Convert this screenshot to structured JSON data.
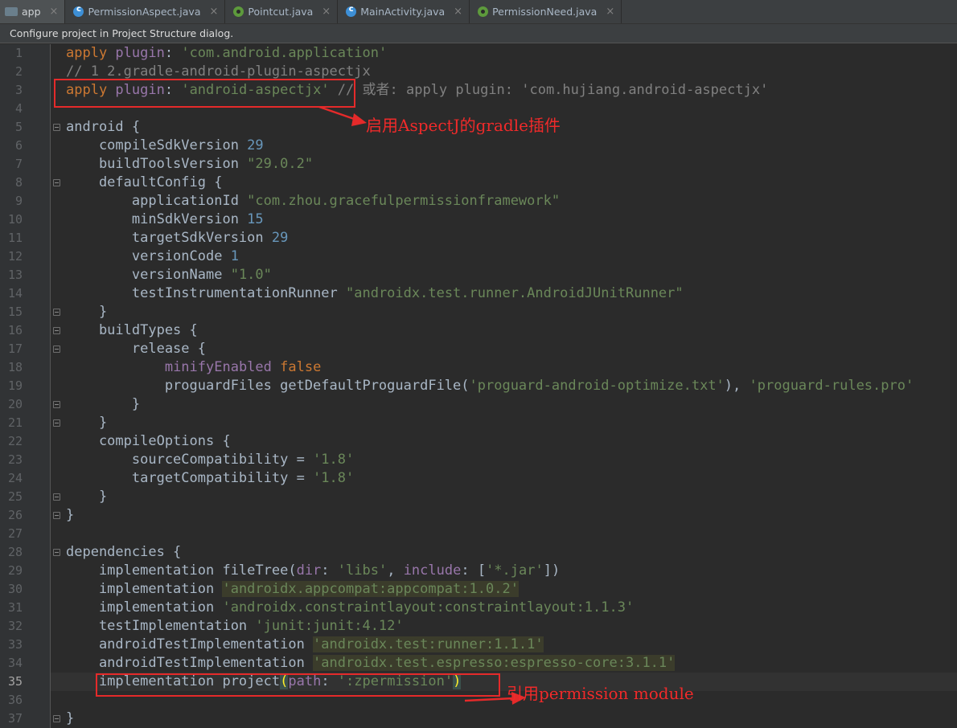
{
  "tabs": [
    {
      "label": "app",
      "icon": "android-module-icon",
      "active": true
    },
    {
      "label": "PermissionAspect.java",
      "icon": "java-class-icon"
    },
    {
      "label": "Pointcut.java",
      "icon": "annotation-icon"
    },
    {
      "label": "MainActivity.java",
      "icon": "java-class-icon"
    },
    {
      "label": "PermissionNeed.java",
      "icon": "annotation-icon"
    }
  ],
  "banner": {
    "text": "Configure project in Project Structure dialog."
  },
  "editor": {
    "current_line": 35,
    "line_numbers": [
      "1",
      "2",
      "3",
      "4",
      "5",
      "6",
      "7",
      "8",
      "9",
      "10",
      "11",
      "12",
      "13",
      "14",
      "15",
      "16",
      "17",
      "18",
      "19",
      "20",
      "21",
      "22",
      "23",
      "24",
      "25",
      "26",
      "27",
      "28",
      "29",
      "30",
      "31",
      "32",
      "33",
      "34",
      "35",
      "36",
      "37"
    ]
  },
  "code": [
    [
      [
        "k",
        "apply"
      ],
      [
        "p",
        " plugin"
      ],
      [
        "pn",
        ": "
      ],
      [
        "s",
        "'com.android.application'"
      ]
    ],
    [
      [
        "c",
        "// 1 2.gradle-android-plugin-aspectjx"
      ]
    ],
    [
      [
        "k",
        "apply"
      ],
      [
        "p",
        " plugin"
      ],
      [
        "pn",
        ": "
      ],
      [
        "s",
        "'android-aspectjx'"
      ],
      [
        "c",
        " // 或者: apply plugin: 'com.hujiang.android-aspectjx'"
      ]
    ],
    [],
    [
      [
        "pn",
        "android {"
      ]
    ],
    [
      [
        "pn",
        "    compileSdkVersion "
      ],
      [
        "n",
        "29"
      ]
    ],
    [
      [
        "pn",
        "    buildToolsVersion "
      ],
      [
        "s",
        "\"29.0.2\""
      ]
    ],
    [
      [
        "pn",
        "    defaultConfig {"
      ]
    ],
    [
      [
        "pn",
        "        applicationId "
      ],
      [
        "s",
        "\"com.zhou.gracefulpermissionframework\""
      ]
    ],
    [
      [
        "pn",
        "        minSdkVersion "
      ],
      [
        "n",
        "15"
      ]
    ],
    [
      [
        "pn",
        "        targetSdkVersion "
      ],
      [
        "n",
        "29"
      ]
    ],
    [
      [
        "pn",
        "        versionCode "
      ],
      [
        "n",
        "1"
      ]
    ],
    [
      [
        "pn",
        "        versionName "
      ],
      [
        "s",
        "\"1.0\""
      ]
    ],
    [
      [
        "pn",
        "        testInstrumentationRunner "
      ],
      [
        "s",
        "\"androidx.test.runner.AndroidJUnitRunner\""
      ]
    ],
    [
      [
        "pn",
        "    }"
      ]
    ],
    [
      [
        "pn",
        "    buildTypes {"
      ]
    ],
    [
      [
        "pn",
        "        release {"
      ]
    ],
    [
      [
        "pn",
        "            "
      ],
      [
        "p",
        "minifyEnabled "
      ],
      [
        "k",
        "false"
      ]
    ],
    [
      [
        "pn",
        "            proguardFiles getDefaultProguardFile("
      ],
      [
        "s",
        "'proguard-android-optimize.txt'"
      ],
      [
        "pn",
        "), "
      ],
      [
        "s",
        "'proguard-rules.pro'"
      ]
    ],
    [
      [
        "pn",
        "        }"
      ]
    ],
    [
      [
        "pn",
        "    }"
      ]
    ],
    [
      [
        "pn",
        "    compileOptions {"
      ]
    ],
    [
      [
        "pn",
        "        sourceCompatibility = "
      ],
      [
        "s",
        "'1.8'"
      ]
    ],
    [
      [
        "pn",
        "        targetCompatibility = "
      ],
      [
        "s",
        "'1.8'"
      ]
    ],
    [
      [
        "pn",
        "    }"
      ]
    ],
    [
      [
        "pn",
        "}"
      ]
    ],
    [],
    [
      [
        "pn",
        "dependencies {"
      ]
    ],
    [
      [
        "pn",
        "    implementation fileTree("
      ],
      [
        "p",
        "dir"
      ],
      [
        "pn",
        ": "
      ],
      [
        "s",
        "'libs'"
      ],
      [
        "pn",
        ", "
      ],
      [
        "p",
        "include"
      ],
      [
        "pn",
        ": ["
      ],
      [
        "s",
        "'*.jar'"
      ],
      [
        "pn",
        "])"
      ]
    ],
    [
      [
        "pn",
        "    implementation "
      ],
      [
        "s hl",
        "'androidx.appcompat:appcompat:1.0.2'"
      ]
    ],
    [
      [
        "pn",
        "    implementation "
      ],
      [
        "s",
        "'androidx.constraintlayout:constraintlayout:1.1.3'"
      ]
    ],
    [
      [
        "pn",
        "    testImplementation "
      ],
      [
        "s",
        "'junit:junit:4.12'"
      ]
    ],
    [
      [
        "pn",
        "    androidTestImplementation "
      ],
      [
        "s hl",
        "'androidx.test:runner:1.1.1'"
      ]
    ],
    [
      [
        "pn",
        "    androidTestImplementation "
      ],
      [
        "s hl",
        "'androidx.test.espresso:espresso-core:3.1.1'"
      ]
    ],
    [
      [
        "pn",
        "    implementation project"
      ],
      [
        "br",
        "("
      ],
      [
        "p",
        "path"
      ],
      [
        "pn",
        ": "
      ],
      [
        "s",
        "':zpermission'"
      ],
      [
        "br",
        ")"
      ]
    ],
    [],
    [
      [
        "pn",
        "}"
      ]
    ]
  ],
  "annotations": {
    "first": "启用AspectJ的gradle插件",
    "second": "引用permission module"
  },
  "colors": {
    "background": "#2b2b2b",
    "gutter": "#313335",
    "keyword": "#cc7832",
    "string": "#6a8759",
    "number": "#6897bb",
    "comment": "#808080",
    "annotation": "#e52a2a"
  }
}
